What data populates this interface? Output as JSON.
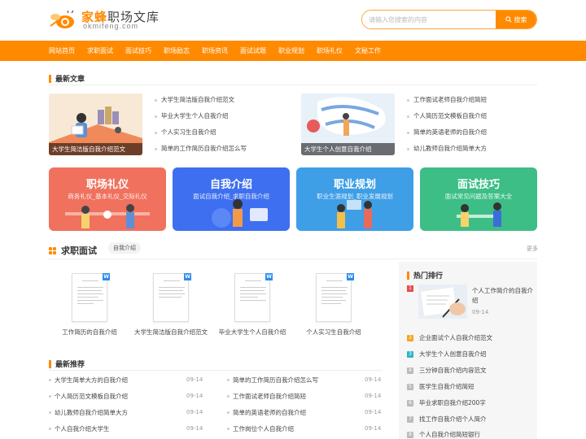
{
  "site": {
    "name_highlight": "家蜂",
    "name_rest": "职场文库",
    "domain": "okmifeng.com",
    "brand_color": "#ff8a00"
  },
  "search": {
    "placeholder": "请输入您搜索的内容",
    "button_label": "搜索",
    "icon": "search-icon"
  },
  "nav": [
    "网站首页",
    "求职面试",
    "面试技巧",
    "职场励志",
    "职场资讯",
    "面试试题",
    "职业规划",
    "职场礼仪",
    "文秘工作"
  ],
  "latest": {
    "title": "最新文章",
    "left": {
      "caption": "大学生简洁版自我介绍范文",
      "items": [
        "大学生简洁版自我介绍范文",
        "毕业大学生个人自我介绍",
        "个人实习生自我介绍",
        "简单的工作简历自我介绍怎么写"
      ]
    },
    "right": {
      "caption": "大学生个人创意自我介绍",
      "items": [
        "工作面试老师自我介绍简短",
        "个人简历范文模板自我介绍",
        "简单的英语老师的自我介绍",
        "幼儿教师自我介绍简单大方"
      ]
    }
  },
  "categories": [
    {
      "title": "职场礼仪",
      "sub": "商务礼仪_基本礼仪_交际礼仪",
      "color": "#f0715e"
    },
    {
      "title": "自我介绍",
      "sub": "面试自我介绍_求职自我介绍",
      "color": "#3d6ff0"
    },
    {
      "title": "职业规划",
      "sub": "职业生涯规划_职业发展规划",
      "color": "#3e9ee6"
    },
    {
      "title": "面试技巧",
      "sub": "面试常见问题及答案大全",
      "color": "#3cbe86"
    }
  ],
  "interview": {
    "title": "求职面试",
    "tag": "自我介绍",
    "more": "更多",
    "docs": [
      "工作简历的自我介绍",
      "大学生简洁版自我介绍范文",
      "毕业大学生个人自我介绍",
      "个人实习生自我介绍"
    ]
  },
  "recommend": {
    "title": "最新推荐",
    "left": [
      {
        "text": "大学生简单大方的自我介绍",
        "date": "09-14"
      },
      {
        "text": "个人简历范文模板自我介绍",
        "date": "09-14"
      },
      {
        "text": "幼儿教师自我介绍简单大方",
        "date": "09-14"
      },
      {
        "text": "个人自我介绍大学生",
        "date": "09-14"
      }
    ],
    "right": [
      {
        "text": "简单的工作简历自我介绍怎么写",
        "date": "09-14"
      },
      {
        "text": "工作面试老师自我介绍简短",
        "date": "09-14"
      },
      {
        "text": "简单的英语老师的自我介绍",
        "date": "09-14"
      },
      {
        "text": "工作岗位个人自我介绍",
        "date": "09-14"
      }
    ]
  },
  "hot": {
    "title": "热门排行",
    "top": {
      "num": "1",
      "text": "个人工作简介的自我介绍",
      "date": "09-14"
    },
    "items": [
      {
        "num": "2",
        "text": "企业面试个人自我介绍范文",
        "color": "#f5a623"
      },
      {
        "num": "3",
        "text": "大学生个人创意自我介绍",
        "color": "#2bb5c9"
      },
      {
        "num": "4",
        "text": "三分钟自我介绍内容范文",
        "color": "#bbbbbb"
      },
      {
        "num": "5",
        "text": "医学生自我介绍简短",
        "color": "#bbbbbb"
      },
      {
        "num": "6",
        "text": "毕业求职自我介绍200字",
        "color": "#bbbbbb"
      },
      {
        "num": "7",
        "text": "找工作自我介绍个人简介",
        "color": "#bbbbbb"
      },
      {
        "num": "8",
        "text": "个人自我介绍简短银行",
        "color": "#bbbbbb"
      }
    ]
  }
}
